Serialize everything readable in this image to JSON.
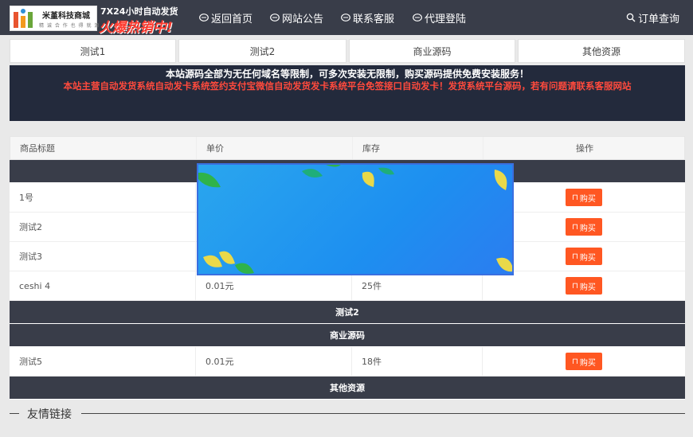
{
  "header": {
    "logo": {
      "name": "米堇科技商城",
      "tagline": "精 诚 合 作 也 得 就 源 头"
    },
    "promo": {
      "line1": "7X24小时自动发货",
      "line2": "火爆热销中!"
    },
    "nav": [
      {
        "label": "返回首页",
        "icon": "back-icon"
      },
      {
        "label": "网站公告",
        "icon": "notice-icon"
      },
      {
        "label": "联系客服",
        "icon": "service-icon"
      },
      {
        "label": "代理登陆",
        "icon": "agent-icon"
      },
      {
        "label": "订单查询",
        "icon": "search-icon"
      }
    ]
  },
  "tabs": [
    "测试1",
    "测试2",
    "商业源码",
    "其他资源"
  ],
  "notice": {
    "line1": "本站源码全部为无任何域名等限制，可多次安装无限制，购买源码提供免费安装服务！",
    "line2": "本站主营自动发货系统自动发卡系统签约支付宝微信自动发货发卡系统平台免签接口自动发卡！发货系统平台源码，若有问题请联系客服网站"
  },
  "table": {
    "headers": [
      "商品标题",
      "单价",
      "库存",
      "操作"
    ],
    "groups": [
      {
        "name": "测试1",
        "rows": [
          {
            "title": "1号",
            "price": "",
            "stock": ""
          },
          {
            "title": "测试2",
            "price": "",
            "stock": ""
          },
          {
            "title": "测试3",
            "price": "",
            "stock": ""
          },
          {
            "title": "ceshi 4",
            "price": "0.01元",
            "stock": "25件"
          }
        ]
      },
      {
        "name": "测试2",
        "rows": []
      },
      {
        "name": "商业源码",
        "rows": [
          {
            "title": "测试5",
            "price": "0.01元",
            "stock": "18件"
          }
        ]
      },
      {
        "name": "其他资源",
        "rows": []
      }
    ],
    "buy_label": "购买"
  },
  "links": {
    "title": "友情链接"
  },
  "colors": {
    "topbar": "#393d49",
    "notice_bg": "#232a3c",
    "notice_red": "#ff4a3d",
    "buy": "#ff5722",
    "group_bar": "#393d49",
    "popup": "#1d8ff0"
  }
}
